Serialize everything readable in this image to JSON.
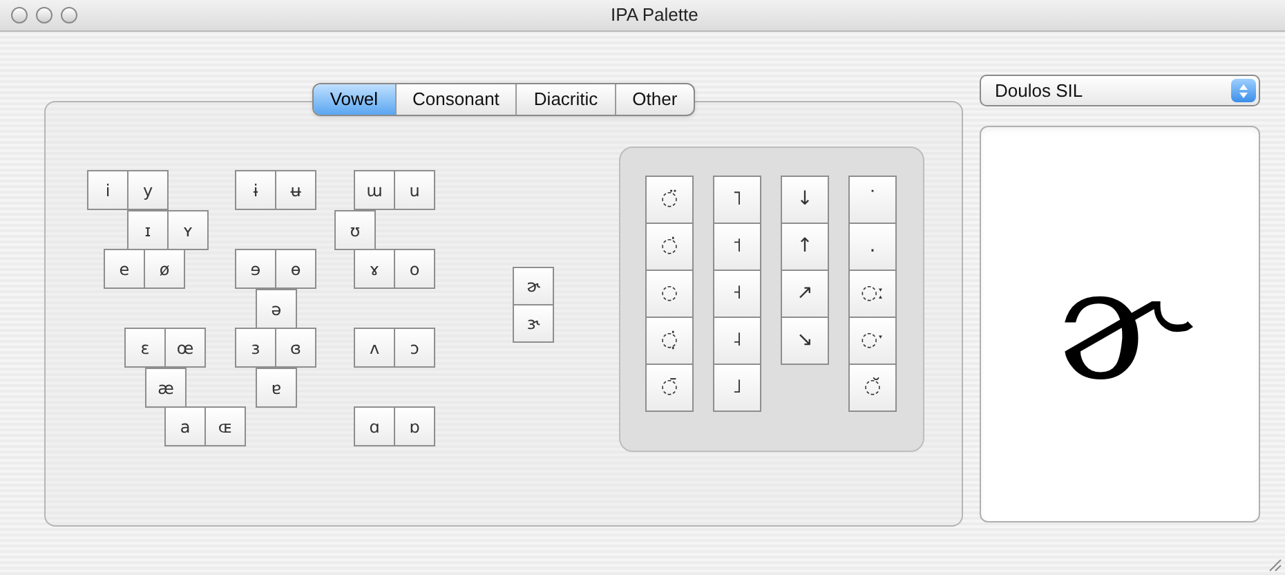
{
  "window": {
    "title": "IPA Palette"
  },
  "tabs": [
    {
      "label": "Vowel",
      "selected": true
    },
    {
      "label": "Consonant",
      "selected": false
    },
    {
      "label": "Diacritic",
      "selected": false
    },
    {
      "label": "Other",
      "selected": false
    }
  ],
  "vowels": [
    "i",
    "y",
    "ɪ",
    "ʏ",
    "e",
    "ø",
    "ɨ",
    "ʉ",
    "ɘ",
    "ɵ",
    "ə",
    "ɜ",
    "ɞ",
    "ɐ",
    "ɯ",
    "u",
    "ʊ",
    "ɤ",
    "o",
    "ʌ",
    "ɔ",
    "ɑ",
    "ɒ",
    "ɛ",
    "œ",
    "æ",
    "a",
    "ɶ"
  ],
  "rhotic_vowels": [
    "ɚ",
    "ɝ"
  ],
  "mark_columns": [
    [
      "◌̈",
      "◌̇",
      "◌",
      "◌̣̇",
      "◌̄"
    ],
    [
      "˥",
      "˦",
      "˧",
      "˨",
      "˩"
    ],
    [
      "↓",
      "↑",
      "↗",
      "↘"
    ],
    [
      "˙",
      ".",
      "◌ː",
      "◌ˑ",
      "◌̆"
    ]
  ],
  "font_popup": {
    "value": "Doulos SIL"
  },
  "preview": {
    "glyph": "ɚ"
  }
}
